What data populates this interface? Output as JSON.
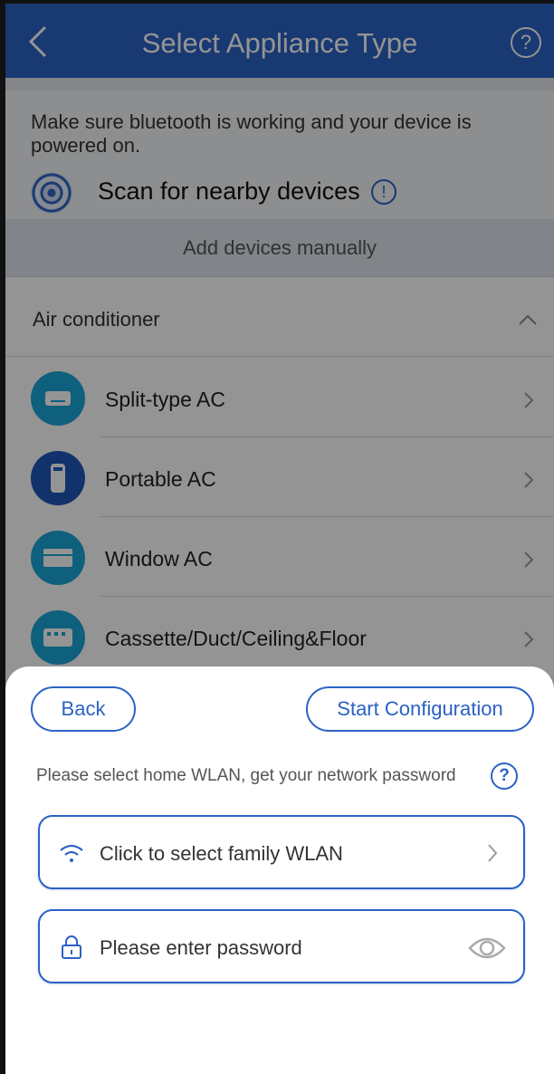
{
  "header": {
    "title": "Select Appliance Type",
    "back_icon": "chevron-left-icon",
    "help_icon": "question-icon",
    "help_glyph": "?"
  },
  "hint": "Make sure bluetooth is working and your device is powered on.",
  "scan": {
    "label": "Scan for nearby devices",
    "icon": "radar-icon",
    "info_icon": "info-icon",
    "info_glyph": "!"
  },
  "manual": {
    "label": "Add devices manually"
  },
  "section": {
    "label": "Air conditioner",
    "expanded": true
  },
  "appliances": [
    {
      "label": "Split-type AC",
      "icon": "split-ac-icon",
      "color": "#1aa6d8"
    },
    {
      "label": "Portable AC",
      "icon": "portable-ac-icon",
      "color": "#1e56b8"
    },
    {
      "label": "Window AC",
      "icon": "window-ac-icon",
      "color": "#1aa6d8"
    },
    {
      "label": "Cassette/Duct/Ceiling&Floor",
      "icon": "cassette-ac-icon",
      "color": "#1aa6d8"
    }
  ],
  "sheet": {
    "back_label": "Back",
    "start_label": "Start Configuration",
    "hint": "Please select home WLAN, get your network password",
    "help_glyph": "?",
    "wlan_placeholder": "Click to select family WLAN",
    "password_placeholder": "Please enter password"
  },
  "colors": {
    "primary": "#2b62c4",
    "teal": "#1aa6d8",
    "overlay": "rgba(0,0,0,0.42)"
  }
}
